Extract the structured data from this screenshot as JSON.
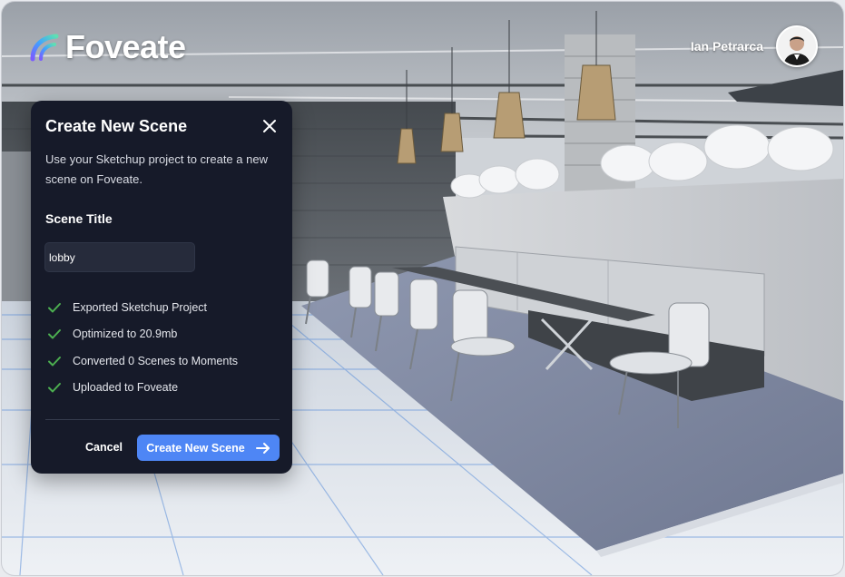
{
  "app": {
    "brand": "Foveate"
  },
  "user": {
    "name": "Ian Petrarca"
  },
  "modal": {
    "title": "Create New Scene",
    "description": "Use your Sketchup project to create a new scene on Foveate.",
    "field_label": "Scene Title",
    "input_value": "lobby",
    "checklist": [
      "Exported Sketchup Project",
      "Optimized to 20.9mb",
      "Converted 0 Scenes to Moments",
      "Uploaded to Foveate"
    ],
    "cancel_label": "Cancel",
    "create_label": "Create New Scene"
  },
  "icons": {
    "close": "close-icon",
    "check": "checkmark-icon",
    "arrow": "arrow-right-icon",
    "logo": "foveate-logo-mark"
  },
  "colors": {
    "modal_bg": "#161a29",
    "accent": "#4e86f5",
    "check_green": "#4caf50"
  }
}
